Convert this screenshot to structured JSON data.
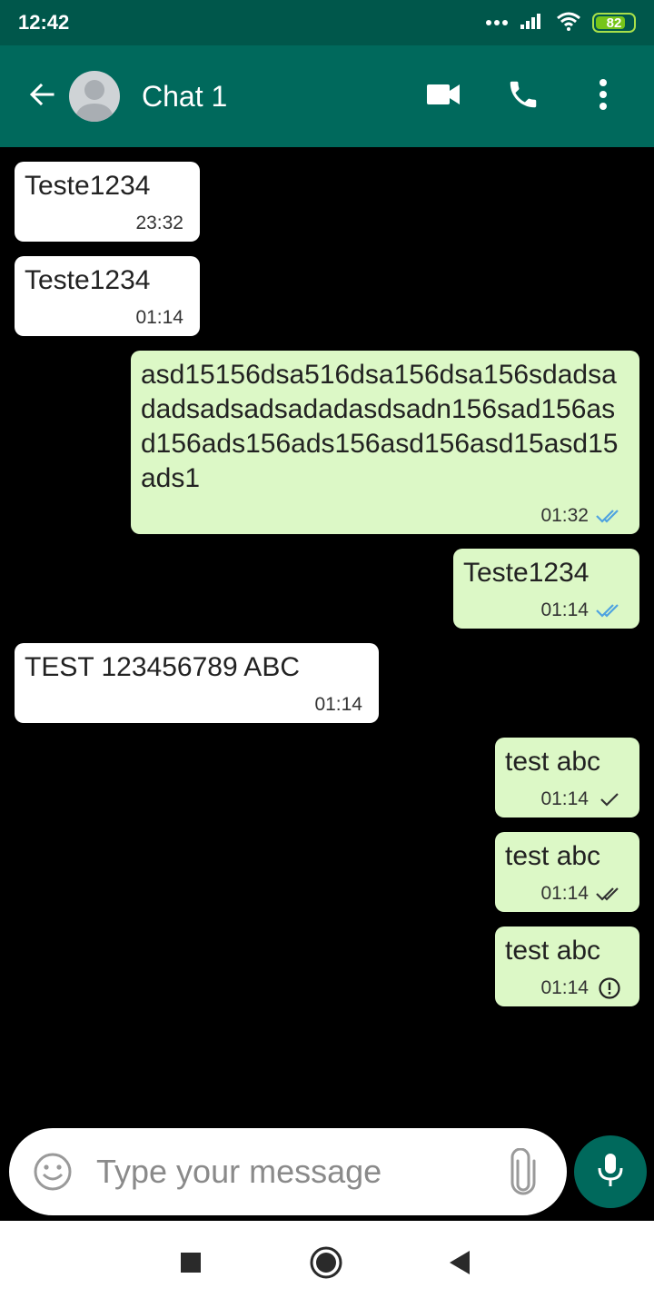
{
  "status_bar": {
    "time": "12:42",
    "battery": "82",
    "battery_fraction": 0.82
  },
  "header": {
    "title": "Chat 1",
    "icons": [
      "back-arrow-icon",
      "avatar",
      "video-call-icon",
      "phone-icon",
      "more-vert-icon"
    ]
  },
  "messages": [
    {
      "direction": "incoming",
      "text": "Teste1234",
      "time": "23:32"
    },
    {
      "direction": "incoming",
      "text": "Teste1234",
      "time": "01:14"
    },
    {
      "direction": "outgoing",
      "text": "asd15156dsa516dsa156dsa156sdadsadadsadsadsadadasdsadn156sad156asd156ads156ads156asd156asd15asd15ads1",
      "time": "01:32",
      "status": "read"
    },
    {
      "direction": "outgoing",
      "text": "Teste1234",
      "time": "01:14",
      "status": "read"
    },
    {
      "direction": "incoming",
      "text": "TEST 123456789 ABC",
      "time": "01:14"
    },
    {
      "direction": "outgoing",
      "text": "test abc",
      "time": "01:14",
      "status": "sent"
    },
    {
      "direction": "outgoing",
      "text": "test abc",
      "time": "01:14",
      "status": "delivered"
    },
    {
      "direction": "outgoing",
      "text": "test abc",
      "time": "01:14",
      "status": "error"
    }
  ],
  "composer": {
    "placeholder": "Type your message"
  },
  "colors": {
    "status_bar": "#00574b",
    "app_bar": "#00695c",
    "outgoing_bubble": "#dcf8c6",
    "incoming_bubble": "#ffffff",
    "read_tick": "#4fa3e0"
  }
}
